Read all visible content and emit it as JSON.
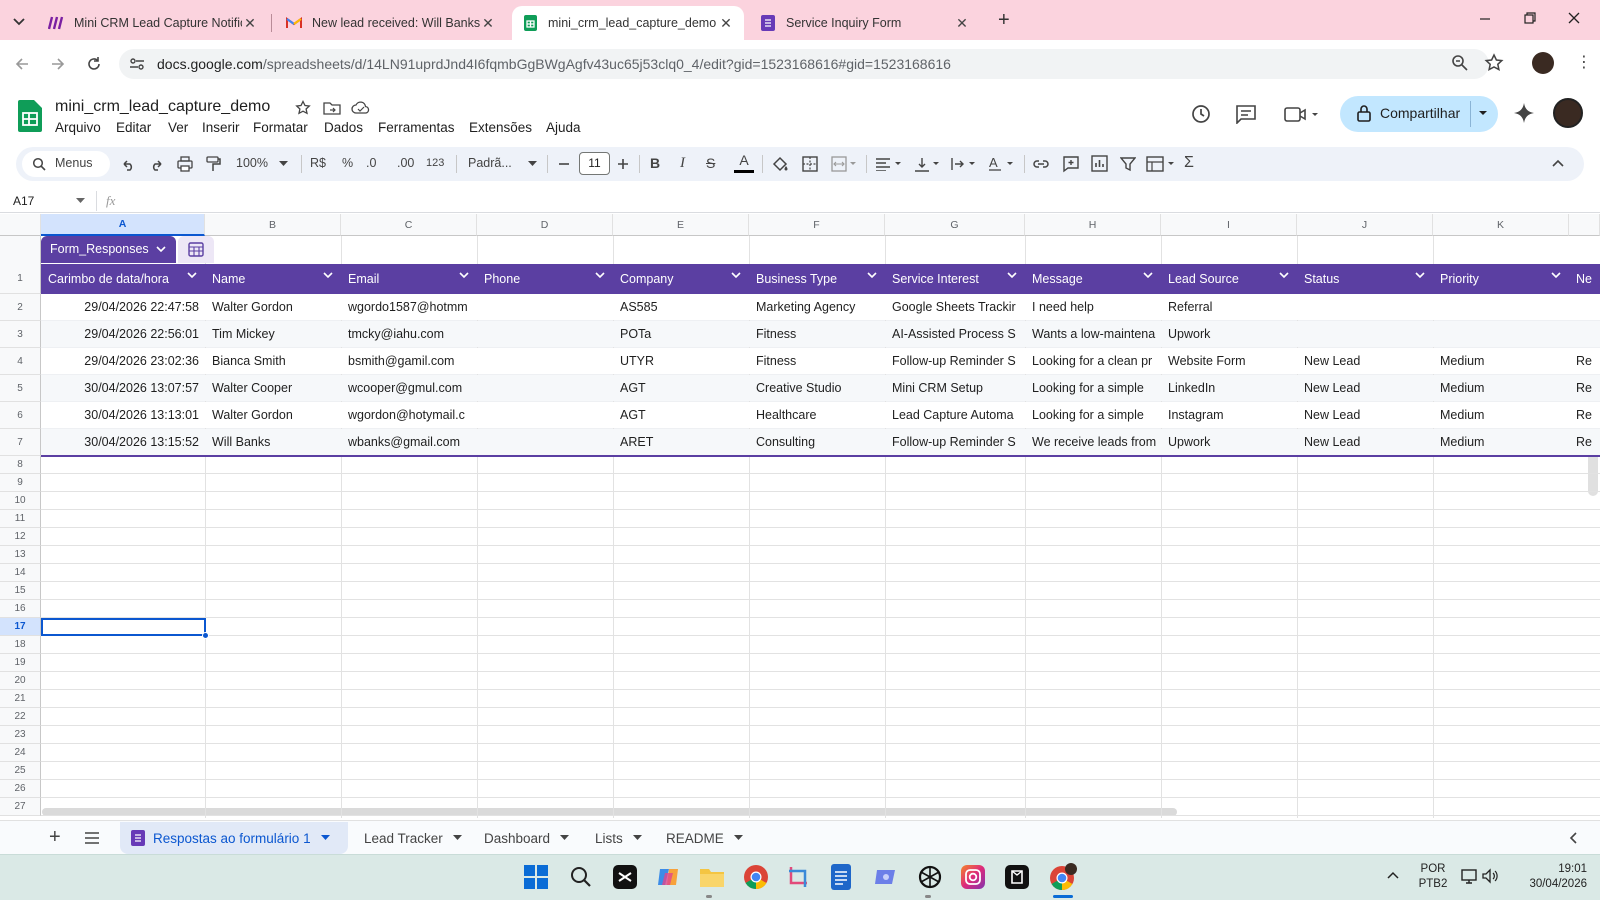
{
  "browser": {
    "tabs": [
      {
        "title": "Mini CRM Lead Capture Notific",
        "icon": "make-icon",
        "active": false
      },
      {
        "title": "New lead received: Will Banks [F",
        "icon": "gmail-icon",
        "active": false
      },
      {
        "title": "mini_crm_lead_capture_demo -",
        "icon": "sheets-icon",
        "active": true
      },
      {
        "title": "Service Inquiry Form",
        "icon": "forms-icon",
        "active": false
      }
    ],
    "url_host": "docs.google.com",
    "url_path": "/spreadsheets/d/14LN91uprdJnd4I6fqmbGgBWgAgfv43uc65j53clq0_4/edit?gid=1523168616#gid=1523168616"
  },
  "sheets": {
    "title": "mini_crm_lead_capture_demo",
    "menu": [
      "Arquivo",
      "Editar",
      "Ver",
      "Inserir",
      "Formatar",
      "Dados",
      "Ferramentas",
      "Extensões",
      "Ajuda"
    ],
    "share_label": "Compartilhar",
    "toolbar": {
      "search": "Menus",
      "zoom": "100%",
      "currency": "R$",
      "percent": "%",
      "dec_decrease": ".0",
      "dec_increase": ".00",
      "number_format": "123",
      "font": "Padrã...",
      "font_size": "11"
    },
    "name_box": "A17",
    "fx": "fx"
  },
  "grid": {
    "columns": [
      "A",
      "B",
      "C",
      "D",
      "E",
      "F",
      "G",
      "H",
      "I",
      "J",
      "K"
    ],
    "selected_column": "A",
    "selected_row": 17,
    "table_name": "Form_Responses",
    "headers": [
      "Carimbo de data/hora",
      "Name",
      "Email",
      "Phone",
      "Company",
      "Business Type",
      "Service Interest",
      "Message",
      "Lead Source",
      "Status",
      "Priority",
      "Ne"
    ],
    "rows": [
      [
        "29/04/2026 22:47:58",
        "Walter Gordon",
        "wgordo1587@hotmm",
        "",
        "AS585",
        "Marketing Agency",
        "Google Sheets Trackir",
        "I need help",
        "Referral",
        "",
        "",
        ""
      ],
      [
        "29/04/2026 22:56:01",
        "Tim Mickey",
        "tmcky@iahu.com",
        "",
        "POTa",
        "Fitness",
        "AI-Assisted Process S",
        "Wants a low-maintena",
        "Upwork",
        "",
        "",
        ""
      ],
      [
        "29/04/2026 23:02:36",
        "Bianca Smith",
        "bsmith@gamil.com",
        "",
        "UTYR",
        "Fitness",
        "Follow-up Reminder S",
        "Looking for a clean pr",
        "Website Form",
        "New Lead",
        "Medium",
        "Re"
      ],
      [
        "30/04/2026 13:07:57",
        "Walter Cooper",
        "wcooper@gmul.com",
        "",
        "AGT",
        "Creative Studio",
        "Mini CRM Setup",
        "Looking for a simple",
        "LinkedIn",
        "New Lead",
        "Medium",
        "Re"
      ],
      [
        "30/04/2026 13:13:01",
        "Walter Gordon",
        "wgordon@hotymail.c",
        "",
        "AGT",
        "Healthcare",
        "Lead Capture Automa",
        "Looking for a simple",
        "Instagram",
        "New Lead",
        "Medium",
        "Re"
      ],
      [
        "30/04/2026 13:15:52",
        "Will Banks",
        "wbanks@gmail.com",
        "",
        "ARET",
        "Consulting",
        "Follow-up Reminder S",
        "We receive leads from",
        "Upwork",
        "New Lead",
        "Medium",
        "Re"
      ]
    ],
    "row_numbers": [
      "1",
      "2",
      "3",
      "4",
      "5",
      "6",
      "7",
      "8",
      "9",
      "10",
      "11",
      "12",
      "13",
      "14",
      "15",
      "16",
      "17",
      "18",
      "19",
      "20",
      "21",
      "22",
      "23",
      "24",
      "25",
      "26",
      "27"
    ]
  },
  "sheet_tabs": [
    "Respostas ao formulário 1",
    "Lead Tracker",
    "Dashboard",
    "Lists",
    "README"
  ],
  "active_sheet_tab": "Respostas ao formulário 1",
  "taskbar": {
    "lang": "POR",
    "layout": "PTB2",
    "time": "19:01",
    "date": "30/04/2026"
  },
  "colors": {
    "tab_strip": "#fbd3de",
    "table_header": "#5b3fa2",
    "selection": "#0b57d0",
    "share_button": "#c2e7ff"
  }
}
